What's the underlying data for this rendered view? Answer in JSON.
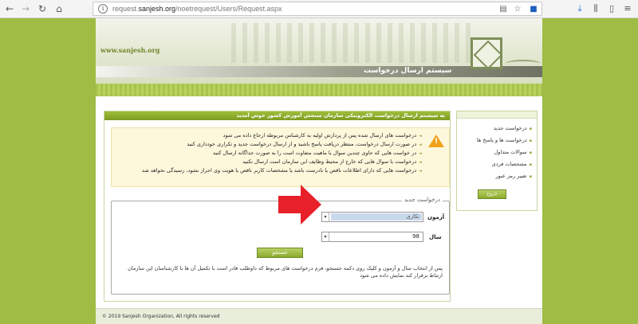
{
  "browser": {
    "url_prefix": "request.",
    "url_domain": "sanjesh.org",
    "url_path": "/noetrequest/Users/Request.aspx",
    "back_icon": "arrow-left-icon",
    "forward_icon": "arrow-right-icon",
    "reload_icon": "reload-icon",
    "home_icon": "home-icon"
  },
  "header": {
    "site_url": "www.sanjesh.org",
    "system_title": "سیستم ارسال درخواست"
  },
  "sidebar": {
    "items": [
      "درخواست جدید",
      "درخواست ها و پاسخ ها",
      "سوالات متداول",
      "مشخصات فردی",
      "تغییر رمز عبور"
    ],
    "exit_label": "خروج"
  },
  "main": {
    "header": "به سیستم ارسال درخواست الکترونیکی سازمان سنجش آموزش کشور خوش آمدید",
    "notices": [
      "درخواست های ارسال شده پس از پردازش اولیه به کارشناس مربوطه ارجاع داده می شود",
      "در صورت ارسال درخواست، منتظر دریافت پاسخ باشید و از ارسال درخواست جدید و تکراری خودداری کنید",
      "در خواست هایی که حاوی چندین سوال با ماهیت متفاوت است را به صورت جداگانه ارسال کنید",
      "درخواست با سوال هایی که خارج از محیط وظایف این سازمان است ارسال نکنید",
      "درخواست هایی که دارای اطلاعات ناقص یا نادرست باشد یا مشخصات کاربر ناقص یا هویت وی احراز نشود، رسیدگی نخواهد شد"
    ],
    "form": {
      "legend": "درخواست جدید",
      "exam_label": "آزمون",
      "exam_value": "تکاری",
      "year_label": "سال",
      "year_value": "98",
      "search_label": "جستجو",
      "help": "پس از انتخاب سال و آزمون و کلیک روی دکمه جستجو، فرم درخواست های مربوط که داوطلب قادر است با تکمیل آن ها با کارشناسان این سازمان ارتباط برقرار کند نمایش داده می شود"
    }
  },
  "footer": {
    "copyright": "© 2019 Sanjesh Organization, All rights reserved"
  },
  "colors": {
    "page_bg": "#9fbc45",
    "accent": "#8cab2c",
    "arrow": "#e8202a"
  }
}
